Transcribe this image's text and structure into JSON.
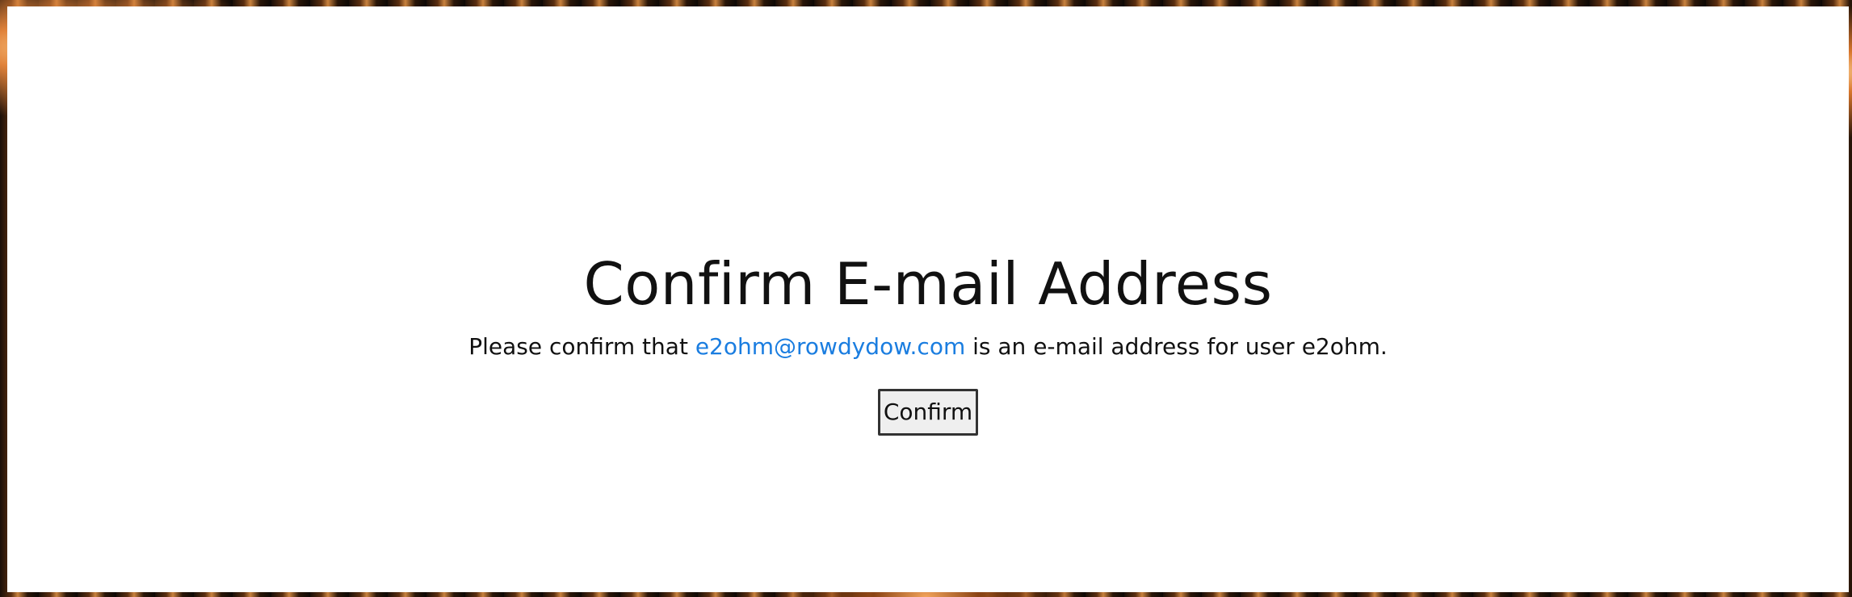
{
  "page": {
    "title": "Confirm E-mail Address",
    "message_prefix": "Please confirm that ",
    "email": "e2ohm@rowdydow.com",
    "message_suffix": " is an e-mail address for user e2ohm.",
    "confirm_label": "Confirm"
  },
  "colors": {
    "link": "#1a7de0",
    "text": "#111111",
    "button_bg": "#efefef"
  }
}
